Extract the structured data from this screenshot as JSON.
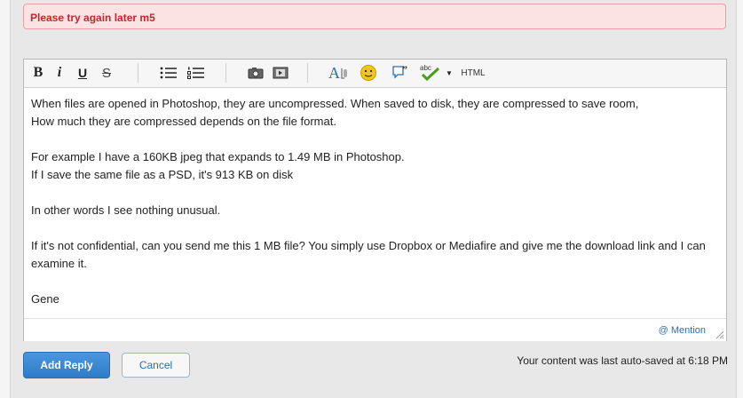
{
  "error": {
    "message": "Please try again later m5"
  },
  "toolbar": {
    "bold_label": "B",
    "italic_label": "i",
    "underline_label": "U",
    "strike_label": "S",
    "spell_label": "abc",
    "html_label": "HTML",
    "icons": [
      "bold-icon",
      "italic-icon",
      "underline-icon",
      "strikethrough-icon",
      "bullet-list-icon",
      "numbered-list-icon",
      "image-icon",
      "video-icon",
      "font-format-icon",
      "emoji-icon",
      "quote-icon",
      "spellcheck-icon",
      "dropdown-icon",
      "html-icon"
    ]
  },
  "editor": {
    "paragraphs": [
      {
        "lines": [
          "When files are opened in Photoshop, they are uncompressed. When saved to disk, they are compressed to save room,",
          "How much they are compressed depends on the file format."
        ]
      },
      {
        "lines": [
          "For example I have a 160KB jpeg that expands to 1.49 MB in Photoshop.",
          "If I save the same file as a PSD, it's 913 KB on disk"
        ]
      },
      {
        "lines": [
          "In other words I see nothing unusual."
        ]
      },
      {
        "lines": [
          "If it's not confidential, can you send me this 1 MB file?  You simply use Dropbox or Mediafire and give me the download link and I can",
          "examine it."
        ]
      },
      {
        "lines": [
          "Gene"
        ]
      }
    ],
    "mention_label": "@ Mention"
  },
  "actions": {
    "add_reply_label": "Add Reply",
    "cancel_label": "Cancel"
  },
  "status": {
    "autosave_text": "Your content was last auto-saved at 6:18 PM"
  },
  "colors": {
    "error_bg": "#fbe3e4",
    "error_text": "#c0282d",
    "primary_button": "#3a88d4",
    "link": "#2a6ebb"
  }
}
